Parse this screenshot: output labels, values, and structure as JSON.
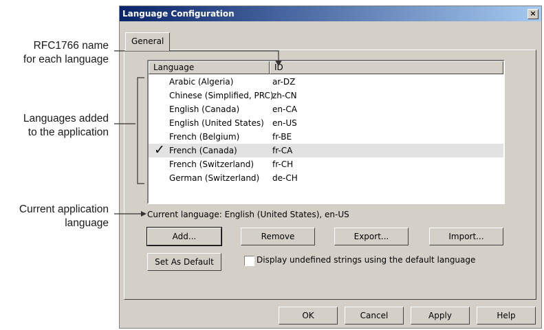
{
  "callouts": {
    "rfc_name": [
      "RFC1766 name",
      "for each language"
    ],
    "languages_added": [
      "Languages added",
      "to the application"
    ],
    "current_language": [
      "Current application",
      "language"
    ]
  },
  "dialog": {
    "title": "Language Configuration",
    "close_glyph": "×",
    "tab": "General",
    "columns": [
      "Language",
      "ID"
    ],
    "rows": [
      {
        "language": "Arabic (Algeria)",
        "id": "ar-DZ"
      },
      {
        "language": "Chinese (Simplified, PRC)",
        "id": "zh-CN"
      },
      {
        "language": "English (Canada)",
        "id": "en-CA"
      },
      {
        "language": "English (United States)",
        "id": "en-US"
      },
      {
        "language": "French (Belgium)",
        "id": "fr-BE"
      },
      {
        "language": "French (Canada)",
        "id": "fr-CA",
        "checked": true,
        "selected": true
      },
      {
        "language": "French (Switzerland)",
        "id": "fr-CH"
      },
      {
        "language": "German (Switzerland)",
        "id": "de-CH"
      }
    ],
    "check_glyph": "✓",
    "current_language": "Current language: English (United States), en-US",
    "buttons": {
      "add": "Add...",
      "remove": "Remove",
      "export": "Export...",
      "import": "Import...",
      "set_default": "Set As Default",
      "ok": "OK",
      "cancel": "Cancel",
      "apply": "Apply",
      "help": "Help"
    },
    "display_undefined": {
      "label": "Display undefined strings using the default language",
      "checked": false
    }
  }
}
